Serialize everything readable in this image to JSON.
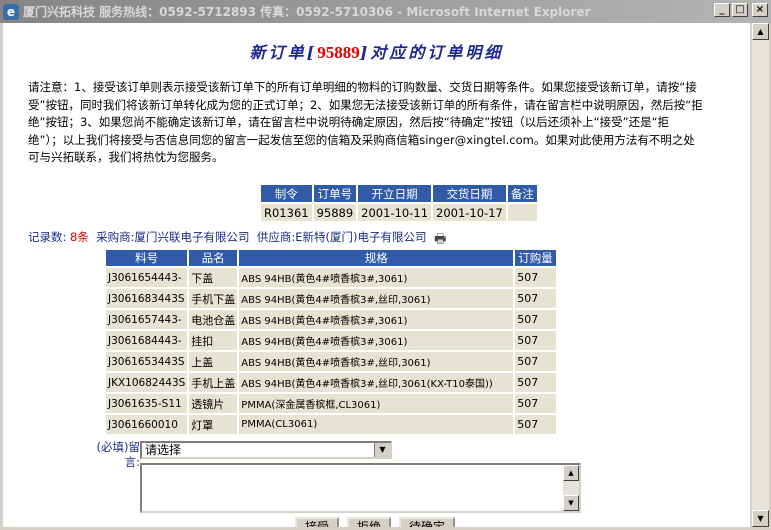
{
  "window": {
    "title": "厦门兴拓科技 服务热线：0592-5712893 传真：0592-5710306 - Microsoft Internet Explorer"
  },
  "heading": {
    "prefix": "新订单[",
    "order_no": "95889",
    "suffix": "]对应的订单明细"
  },
  "notice": {
    "lines": [
      "请注意：1、接受该订单则表示接受该新订单下的所有订单明细的物料的订购数量、交货日期等条件。如果您接受该新订单，请按“接",
      "受”按钮，同时我们将该新订单转化成为您的正式订单；2、如果您无法接受该新订单的所有条件，请在留言栏中说明原因，然后按“拒",
      "绝”按钮；3、如果您尚不能确定该新订单，请在留言栏中说明待确定原因，然后按“待确定”按钮（以后还须补上“接受”还是“拒",
      "绝”）；以上我们将接受与否信息同您的留言一起发信至您的信箱及采购商信箱singer@xingtel.com。如果对此使用方法有不明之处",
      "可与兴拓联系，我们将热忱为您服务。"
    ]
  },
  "order_table": {
    "headers": [
      "制令",
      "订单号",
      "开立日期",
      "交货日期",
      "备注"
    ],
    "row": [
      "R01361",
      "95889",
      "2001-10-11",
      "2001-10-17",
      ""
    ]
  },
  "info": {
    "count_label": "记录数:",
    "count_value": "8条",
    "buyer": "采购商:厦门兴联电子有限公司",
    "supplier": "供应商:E新特(厦门)电子有限公司",
    "print_icon": "printer-icon"
  },
  "items_table": {
    "headers": [
      "料号",
      "品名",
      "规格",
      "订购量"
    ],
    "rows": [
      [
        "J3061654443-",
        "下盖",
        "ABS 94HB(黄色4#喷香槟3#,3061)",
        "507"
      ],
      [
        "J3061683443S",
        "手机下盖",
        "ABS 94HB(黄色4#喷香槟3#,丝印,3061)",
        "507"
      ],
      [
        "J3061657443-",
        "电池仓盖",
        "ABS 94HB(黄色4#喷香槟3#,3061)",
        "507"
      ],
      [
        "J3061684443-",
        "挂扣",
        "ABS 94HB(黄色4#喷香槟3#,3061)",
        "507"
      ],
      [
        "J3061653443S",
        "上盖",
        "ABS 94HB(黄色4#喷香槟3#,丝印,3061)",
        "507"
      ],
      [
        "JKX10682443S",
        "手机上盖",
        "ABS 94HB(黄色4#喷香槟3#,丝印,3061(KX-T10泰国))",
        "507"
      ],
      [
        "J3061635-S11",
        "透镜片",
        "PMMA(深金属香槟框,CL3061)",
        "507"
      ],
      [
        "J3061660010",
        "灯罩",
        "PMMA(CL3061)",
        "507"
      ]
    ]
  },
  "form": {
    "remark_label": "(必填)留言:",
    "select_value": "请选择",
    "textarea_value": ""
  },
  "buttons": {
    "accept": "接受",
    "reject": "拒绝",
    "pending": "待确定"
  },
  "colors": {
    "header_blue": "#315ba8",
    "cell_bg": "#e6e3d3",
    "highlight_red": "#e00000",
    "text_blue": "#1a2f80"
  }
}
